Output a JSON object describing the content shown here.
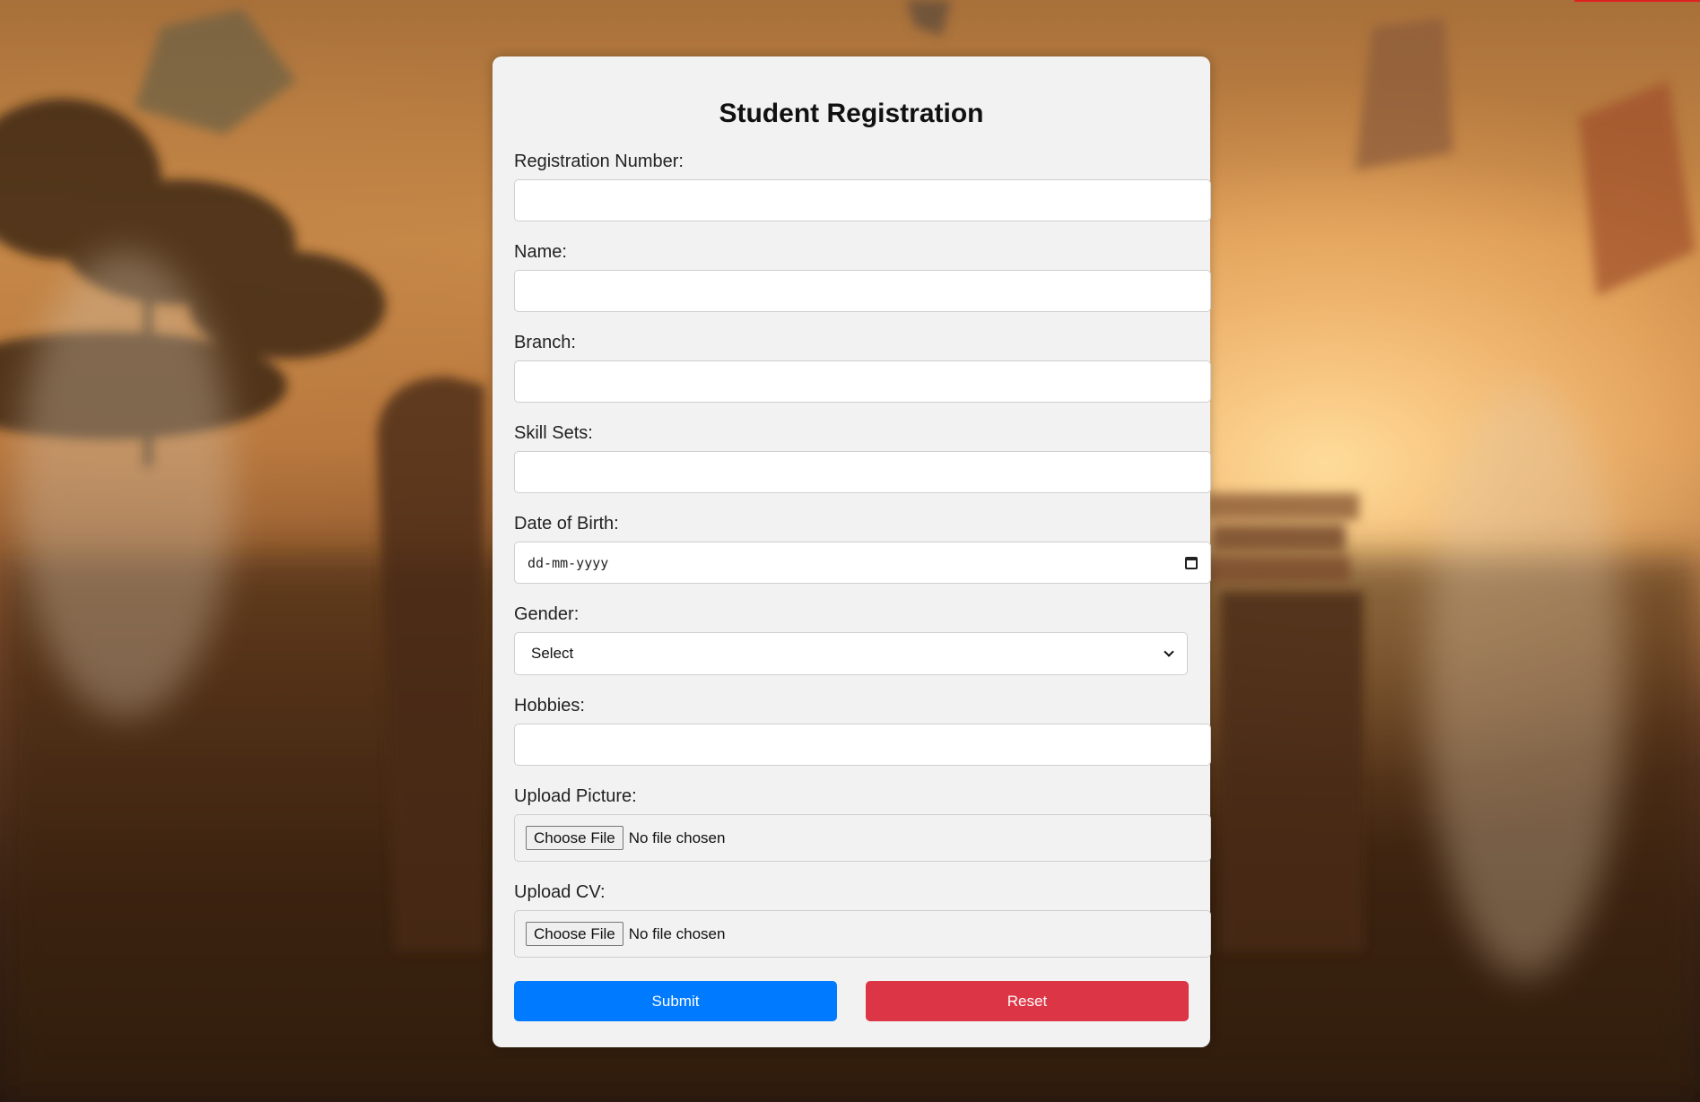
{
  "form": {
    "title": "Student Registration",
    "fields": {
      "registration_number": {
        "label": "Registration Number:",
        "value": ""
      },
      "name": {
        "label": "Name:",
        "value": ""
      },
      "branch": {
        "label": "Branch:",
        "value": ""
      },
      "skill_sets": {
        "label": "Skill Sets:",
        "value": ""
      },
      "date_of_birth": {
        "label": "Date of Birth:",
        "placeholder": "dd-mm-yyyy"
      },
      "gender": {
        "label": "Gender:",
        "selected": "Select"
      },
      "hobbies": {
        "label": "Hobbies:",
        "value": ""
      },
      "upload_picture": {
        "label": "Upload Picture:",
        "button": "Choose File",
        "status": "No file chosen"
      },
      "upload_cv": {
        "label": "Upload CV:",
        "button": "Choose File",
        "status": "No file chosen"
      }
    },
    "buttons": {
      "submit": "Submit",
      "reset": "Reset"
    }
  },
  "colors": {
    "card_background": "#f2f2f2",
    "submit": "#007bff",
    "reset": "#dc3545"
  },
  "icons": {
    "date": "calendar-icon",
    "select": "chevron-down-icon"
  }
}
